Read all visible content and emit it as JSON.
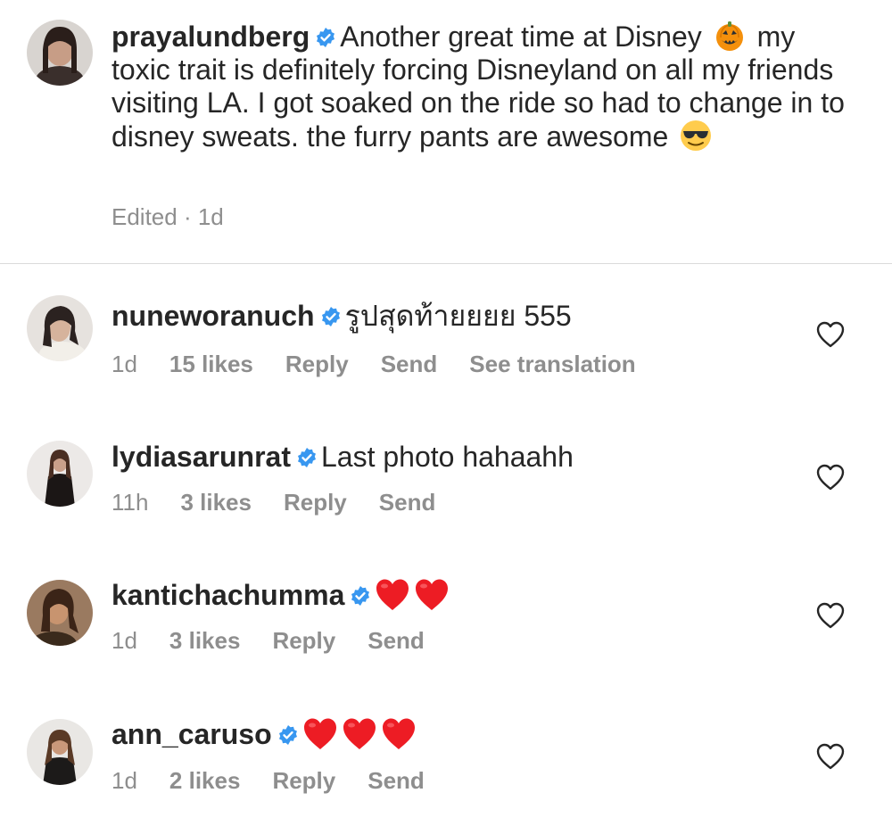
{
  "caption": {
    "username": "prayalundberg",
    "text_part1": "Another great time at Disney",
    "text_part2": "my toxic trait is definitely forcing Disneyland on all my friends visiting LA. I got soaked on the ride so had to change in to disney sweats. the furry pants are awesome",
    "meta": "Edited · 1d"
  },
  "comments": [
    {
      "username": "nuneworanuch",
      "text": "รูปสุดท้ายยยย 555",
      "time": "1d",
      "likes": "15 likes",
      "reply": "Reply",
      "send": "Send",
      "translate": "See translation"
    },
    {
      "username": "lydiasarunrat",
      "text": "Last photo hahaahh",
      "time": "11h",
      "likes": "3 likes",
      "reply": "Reply",
      "send": "Send"
    },
    {
      "username": "kantichachumma",
      "text": "",
      "time": "1d",
      "likes": "3 likes",
      "reply": "Reply",
      "send": "Send"
    },
    {
      "username": "ann_caruso",
      "text": "",
      "time": "1d",
      "likes": "2 likes",
      "reply": "Reply",
      "send": "Send"
    }
  ],
  "colors": {
    "text": "#262626",
    "secondary": "#8e8e8e",
    "verified": "#3897f0",
    "heart": "#ed1c24",
    "divider": "#dbdbdb"
  },
  "icons": {
    "verified": "verified-badge-icon",
    "like": "heart-outline-icon",
    "pumpkin": "jack-o-lantern-emoji",
    "sunglasses": "smiling-face-with-sunglasses-emoji",
    "red_heart": "red-heart-emoji"
  }
}
